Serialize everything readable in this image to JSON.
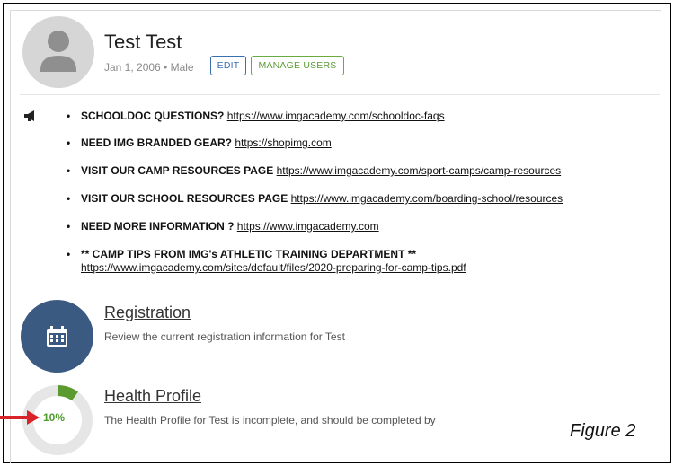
{
  "profile": {
    "name": "Test Test",
    "meta": "Jan 1, 2006 • Male",
    "edit_label": "EDIT",
    "manage_label": "MANAGE USERS"
  },
  "announcements": [
    {
      "label": "SCHOOLDOC QUESTIONS?",
      "link": "https://www.imgacademy.com/schooldoc-faqs"
    },
    {
      "label": "NEED IMG BRANDED GEAR?",
      "link": "https://shopimg.com"
    },
    {
      "label": "VISIT OUR CAMP RESOURCES PAGE",
      "link": "https://www.imgacademy.com/sport-camps/camp-resources"
    },
    {
      "label": "VISIT OUR SCHOOL RESOURCES PAGE",
      "link": "https://www.imgacademy.com/boarding-school/resources"
    },
    {
      "label": "NEED MORE INFORMATION ?",
      "link": "https://www.imgacademy.com"
    },
    {
      "label": "** CAMP TIPS FROM IMG's ATHLETIC TRAINING DEPARTMENT **",
      "link": "https://www.imgacademy.com/sites/default/files/2020-preparing-for-camp-tips.pdf"
    }
  ],
  "registration": {
    "title": "Registration",
    "description": "Review the current registration information for Test",
    "icon": "calendar-icon",
    "color": "#3b5a82"
  },
  "health": {
    "title": "Health Profile",
    "description": "The Health Profile for Test is incomplete, and should be completed by",
    "percent_label": "10%",
    "progress": 0.1,
    "ring_color": "#e6e6e6",
    "fill_color": "#5a9a2e"
  },
  "caption": "Figure 2",
  "colors": {
    "edit": "#3b6fb0",
    "manage": "#6aab3f",
    "arrow": "#d9232b"
  }
}
